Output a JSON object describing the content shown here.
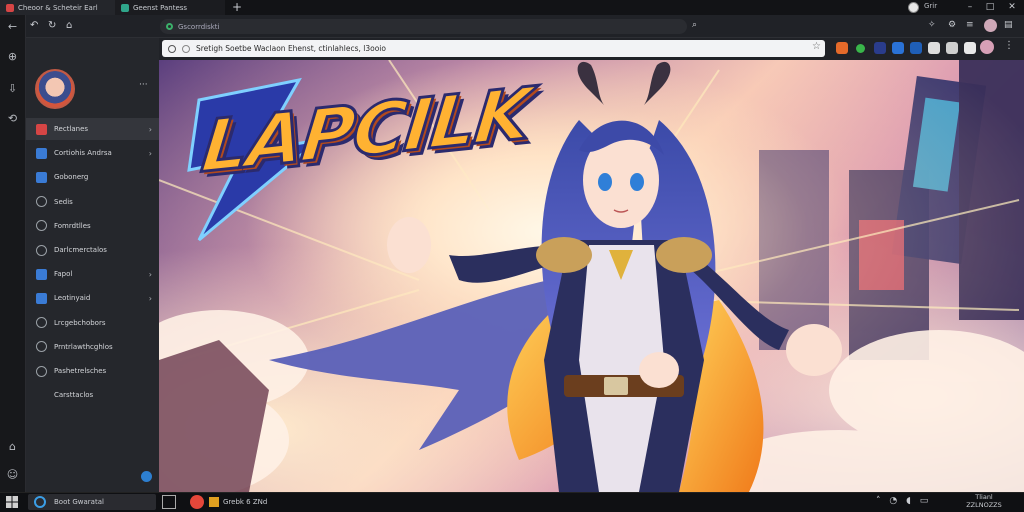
{
  "tabs": [
    {
      "label": "Cheoor & Scheteir Earl"
    },
    {
      "label": "Geenst Pantess"
    }
  ],
  "window": {
    "profile_name": "Grir",
    "new_tab": "+",
    "min": "–",
    "max": "□",
    "close": "✕"
  },
  "toolbar_top": {
    "address": "Gscorrdiskti",
    "back": "←"
  },
  "omnibox": {
    "url": "Sretigh Soetbe Waclaon Ehenst, ctinlahlecs, l3ooio"
  },
  "sidebar": {
    "more": "···",
    "items": [
      {
        "label": "Rectlanes",
        "color": "#d64545",
        "chevron": true
      },
      {
        "label": "Cortiohis Andrsa",
        "color": "#3a7bd5",
        "chevron": true
      },
      {
        "label": "Gobonerg",
        "color": "#3a7bd5",
        "chevron": false
      },
      {
        "label": "Sedis",
        "color": "#9aa0a6",
        "chevron": false
      },
      {
        "label": "Fomrdtlles",
        "color": "#9aa0a6",
        "chevron": false
      },
      {
        "label": "Darlcmerctalos",
        "color": "#9aa0a6",
        "chevron": false
      },
      {
        "label": "Fapol",
        "color": "#3a7bd5",
        "chevron": true
      },
      {
        "label": "Leotinyaid",
        "color": "#3a7bd5",
        "chevron": true
      },
      {
        "label": "Lrcgebchobors",
        "color": "#9aa0a6",
        "chevron": false
      },
      {
        "label": "Prntrlawthcghlos",
        "color": "#9aa0a6",
        "chevron": false
      },
      {
        "label": "Pashetrelsches",
        "color": "#9aa0a6",
        "chevron": false
      },
      {
        "label": "Carsttaclos",
        "color": "",
        "chevron": false
      }
    ]
  },
  "hero": {
    "logo_text": "LAPCILK"
  },
  "taskbar": {
    "search": "Boot Gwaratal",
    "active_app": "Grebk 6 ZNd",
    "clock_time": "Tlianl",
    "clock_date": "ZZLNOZZS"
  }
}
